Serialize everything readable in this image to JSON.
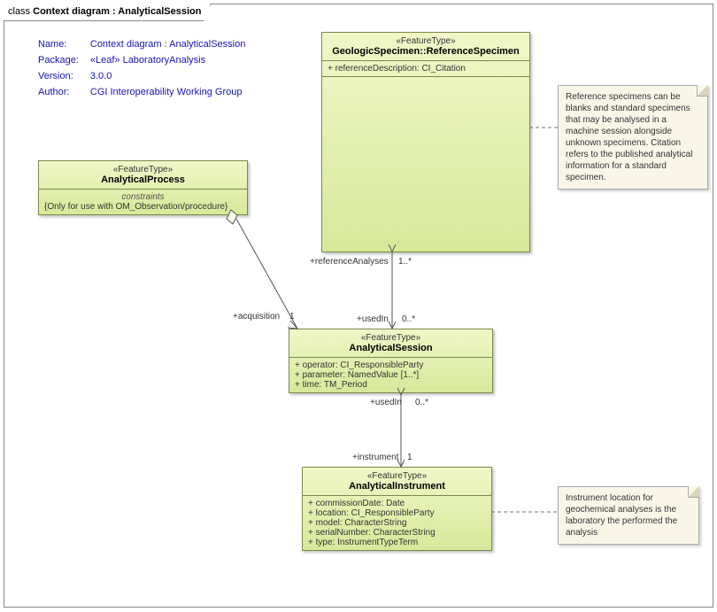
{
  "title": {
    "prefix": "class ",
    "name": "Context diagram : AnalyticalSession"
  },
  "meta": {
    "name_label": "Name:",
    "name_value": "Context diagram : AnalyticalSession",
    "package_label": "Package:",
    "package_value": "«Leaf» LaboratoryAnalysis",
    "version_label": "Version:",
    "version_value": "3.0.0",
    "author_label": "Author:",
    "author_value": "CGI Interoperability Working Group"
  },
  "classes": {
    "referenceSpecimen": {
      "stereotype": "«FeatureType»",
      "name": "GeologicSpecimen::ReferenceSpecimen",
      "attr1": "+   referenceDescription: CI_Citation"
    },
    "analyticalProcess": {
      "stereotype": "«FeatureType»",
      "name": "AnalyticalProcess",
      "constraints_hdr": "constraints",
      "constraint1": "{Only for use with OM_Observation/procedure}"
    },
    "analyticalSession": {
      "stereotype": "«FeatureType»",
      "name": "AnalyticalSession",
      "attr1": "+   operator: CI_ResponsibleParty",
      "attr2": "+   parameter: NamedValue [1..*]",
      "attr3": "+   time: TM_Period"
    },
    "analyticalInstrument": {
      "stereotype": "«FeatureType»",
      "name": "AnalyticalInstrument",
      "attr1": "+   commissionDate: Date",
      "attr2": "+   location: CI_ResponsibleParty",
      "attr3": "+   model: CharacterString",
      "attr4": "+   serialNumber: CharacterString",
      "attr5": "+   type: InstrumentTypeTerm"
    }
  },
  "assocs": {
    "refAnalyses_role": "+referenceAnalyses",
    "refAnalyses_mult": "1..*",
    "usedIn_top_role": "+usedIn",
    "usedIn_top_mult": "0..*",
    "usedIn_bot_role": "+usedIn",
    "usedIn_bot_mult": "0..*",
    "instrument_role": "+instrument",
    "instrument_mult": "1",
    "acquisition_role": "+acquisition",
    "acquisition_mult": "1"
  },
  "notes": {
    "note1": "Reference specimens can be blanks and standard specimens that may be analysed in a machine session alongside unknown specimens. Citation refers to the published analytical information for a standard specimen.",
    "note2": "Instrument location for geochemical analyses is the laboratory the performed the analysis"
  }
}
